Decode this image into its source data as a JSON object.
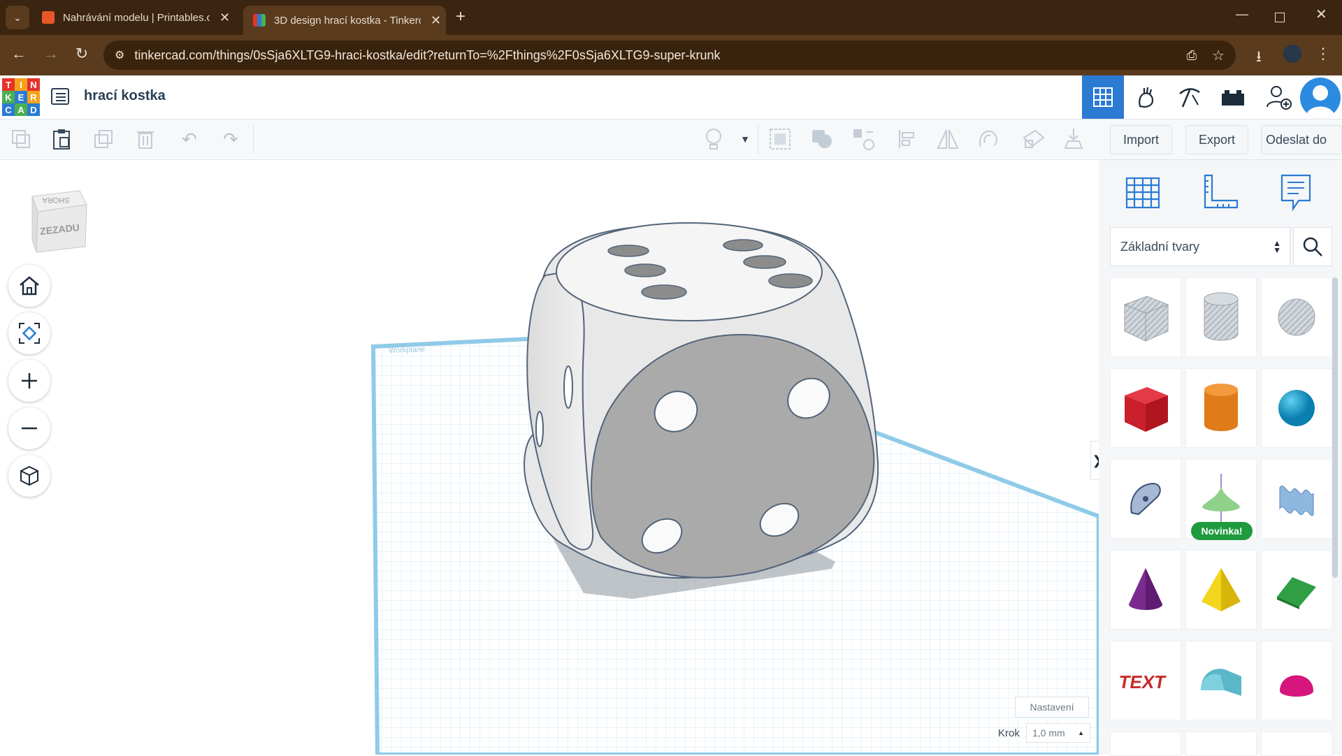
{
  "browser": {
    "tabs": [
      {
        "title": "Nahrávání modelu | Printables.c",
        "active": false
      },
      {
        "title": "3D design hrací kostka - Tinkerc",
        "active": true
      }
    ],
    "new_tab": "+",
    "url": "tinkercad.com/things/0sSja6XLTG9-hraci-kostka/edit?returnTo=%2Fthings%2F0sSja6XLTG9-super-krunk"
  },
  "app": {
    "logo_letters": [
      "T",
      "I",
      "N",
      "K",
      "E",
      "R",
      "C",
      "A",
      "D"
    ],
    "design_title": "hrací kostka"
  },
  "toolbar": {
    "import": "Import",
    "export": "Export",
    "send_to": "Odeslat do"
  },
  "viewcube": {
    "top_face": "SHORA",
    "front_face": "ZEZADU"
  },
  "workplane": {
    "label": "Workplane"
  },
  "bottom": {
    "settings": "Nastavení",
    "step_label": "Krok",
    "step_value": "1,0 mm"
  },
  "panel": {
    "category": "Základní tvary",
    "new_badge": "Novinka!",
    "text_shape": "TEXT"
  },
  "colors": {
    "tab_bar": "#3b2410",
    "url_bar": "#5a3b1d",
    "accent_blue": "#2b7bd3",
    "badge_green": "#1f9a3e",
    "grid": "#cfe8f4"
  }
}
